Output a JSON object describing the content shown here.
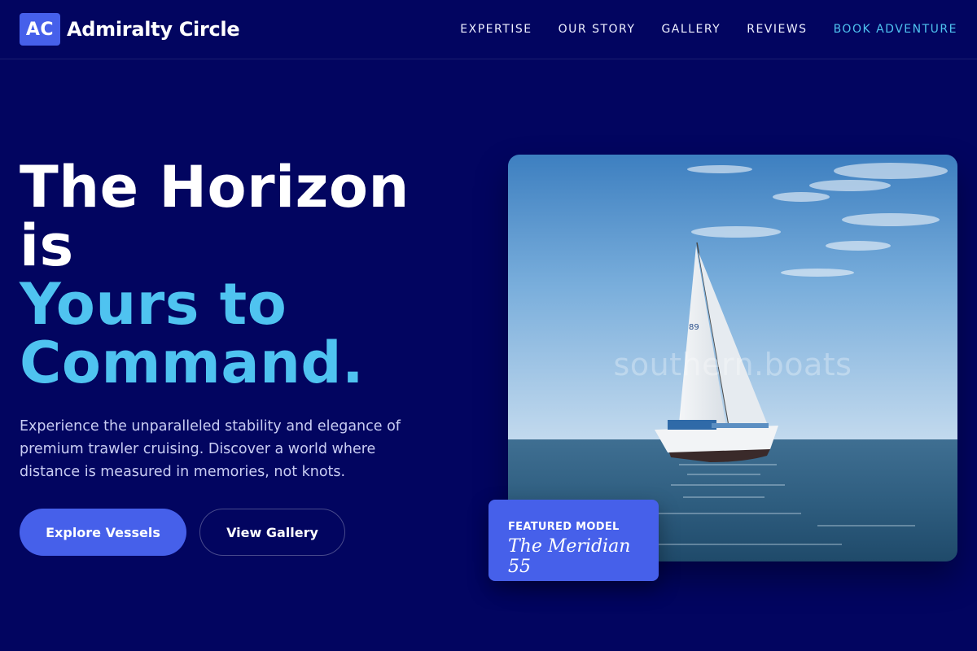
{
  "brand": {
    "logo_text": "AC",
    "name": "Admiralty Circle"
  },
  "nav": {
    "items": [
      {
        "label": "EXPERTISE"
      },
      {
        "label": "OUR STORY"
      },
      {
        "label": "GALLERY"
      },
      {
        "label": "REVIEWS"
      },
      {
        "label": "BOOK ADVENTURE"
      }
    ]
  },
  "hero": {
    "title_line1": "The Horizon",
    "title_line2": "is",
    "title_accent_line1": "Yours to",
    "title_accent_line2": "Command.",
    "description": "Experience the unparalleled stability and elegance of premium trawler cruising. Discover a world where distance is measured in memories, not knots.",
    "primary_button": "Explore Vessels",
    "secondary_button": "View Gallery"
  },
  "image": {
    "watermark": "southern.boats",
    "sail_number": "89"
  },
  "featured": {
    "label": "FEATURED MODEL",
    "name": "The Meridian 55"
  },
  "colors": {
    "background": "#020560",
    "accent": "#4fc3f0",
    "primary": "#4660ea"
  }
}
